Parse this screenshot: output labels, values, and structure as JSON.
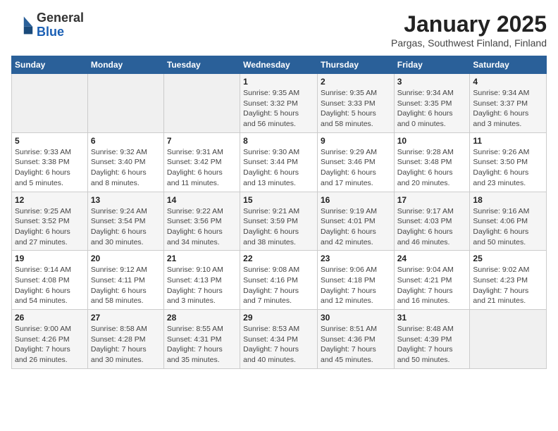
{
  "header": {
    "logo_line1": "General",
    "logo_line2": "Blue",
    "title": "January 2025",
    "subtitle": "Pargas, Southwest Finland, Finland"
  },
  "days_of_week": [
    "Sunday",
    "Monday",
    "Tuesday",
    "Wednesday",
    "Thursday",
    "Friday",
    "Saturday"
  ],
  "weeks": [
    [
      {
        "day": "",
        "info": ""
      },
      {
        "day": "",
        "info": ""
      },
      {
        "day": "",
        "info": ""
      },
      {
        "day": "1",
        "info": "Sunrise: 9:35 AM\nSunset: 3:32 PM\nDaylight: 5 hours\nand 56 minutes."
      },
      {
        "day": "2",
        "info": "Sunrise: 9:35 AM\nSunset: 3:33 PM\nDaylight: 5 hours\nand 58 minutes."
      },
      {
        "day": "3",
        "info": "Sunrise: 9:34 AM\nSunset: 3:35 PM\nDaylight: 6 hours\nand 0 minutes."
      },
      {
        "day": "4",
        "info": "Sunrise: 9:34 AM\nSunset: 3:37 PM\nDaylight: 6 hours\nand 3 minutes."
      }
    ],
    [
      {
        "day": "5",
        "info": "Sunrise: 9:33 AM\nSunset: 3:38 PM\nDaylight: 6 hours\nand 5 minutes."
      },
      {
        "day": "6",
        "info": "Sunrise: 9:32 AM\nSunset: 3:40 PM\nDaylight: 6 hours\nand 8 minutes."
      },
      {
        "day": "7",
        "info": "Sunrise: 9:31 AM\nSunset: 3:42 PM\nDaylight: 6 hours\nand 11 minutes."
      },
      {
        "day": "8",
        "info": "Sunrise: 9:30 AM\nSunset: 3:44 PM\nDaylight: 6 hours\nand 13 minutes."
      },
      {
        "day": "9",
        "info": "Sunrise: 9:29 AM\nSunset: 3:46 PM\nDaylight: 6 hours\nand 17 minutes."
      },
      {
        "day": "10",
        "info": "Sunrise: 9:28 AM\nSunset: 3:48 PM\nDaylight: 6 hours\nand 20 minutes."
      },
      {
        "day": "11",
        "info": "Sunrise: 9:26 AM\nSunset: 3:50 PM\nDaylight: 6 hours\nand 23 minutes."
      }
    ],
    [
      {
        "day": "12",
        "info": "Sunrise: 9:25 AM\nSunset: 3:52 PM\nDaylight: 6 hours\nand 27 minutes."
      },
      {
        "day": "13",
        "info": "Sunrise: 9:24 AM\nSunset: 3:54 PM\nDaylight: 6 hours\nand 30 minutes."
      },
      {
        "day": "14",
        "info": "Sunrise: 9:22 AM\nSunset: 3:56 PM\nDaylight: 6 hours\nand 34 minutes."
      },
      {
        "day": "15",
        "info": "Sunrise: 9:21 AM\nSunset: 3:59 PM\nDaylight: 6 hours\nand 38 minutes."
      },
      {
        "day": "16",
        "info": "Sunrise: 9:19 AM\nSunset: 4:01 PM\nDaylight: 6 hours\nand 42 minutes."
      },
      {
        "day": "17",
        "info": "Sunrise: 9:17 AM\nSunset: 4:03 PM\nDaylight: 6 hours\nand 46 minutes."
      },
      {
        "day": "18",
        "info": "Sunrise: 9:16 AM\nSunset: 4:06 PM\nDaylight: 6 hours\nand 50 minutes."
      }
    ],
    [
      {
        "day": "19",
        "info": "Sunrise: 9:14 AM\nSunset: 4:08 PM\nDaylight: 6 hours\nand 54 minutes."
      },
      {
        "day": "20",
        "info": "Sunrise: 9:12 AM\nSunset: 4:11 PM\nDaylight: 6 hours\nand 58 minutes."
      },
      {
        "day": "21",
        "info": "Sunrise: 9:10 AM\nSunset: 4:13 PM\nDaylight: 7 hours\nand 3 minutes."
      },
      {
        "day": "22",
        "info": "Sunrise: 9:08 AM\nSunset: 4:16 PM\nDaylight: 7 hours\nand 7 minutes."
      },
      {
        "day": "23",
        "info": "Sunrise: 9:06 AM\nSunset: 4:18 PM\nDaylight: 7 hours\nand 12 minutes."
      },
      {
        "day": "24",
        "info": "Sunrise: 9:04 AM\nSunset: 4:21 PM\nDaylight: 7 hours\nand 16 minutes."
      },
      {
        "day": "25",
        "info": "Sunrise: 9:02 AM\nSunset: 4:23 PM\nDaylight: 7 hours\nand 21 minutes."
      }
    ],
    [
      {
        "day": "26",
        "info": "Sunrise: 9:00 AM\nSunset: 4:26 PM\nDaylight: 7 hours\nand 26 minutes."
      },
      {
        "day": "27",
        "info": "Sunrise: 8:58 AM\nSunset: 4:28 PM\nDaylight: 7 hours\nand 30 minutes."
      },
      {
        "day": "28",
        "info": "Sunrise: 8:55 AM\nSunset: 4:31 PM\nDaylight: 7 hours\nand 35 minutes."
      },
      {
        "day": "29",
        "info": "Sunrise: 8:53 AM\nSunset: 4:34 PM\nDaylight: 7 hours\nand 40 minutes."
      },
      {
        "day": "30",
        "info": "Sunrise: 8:51 AM\nSunset: 4:36 PM\nDaylight: 7 hours\nand 45 minutes."
      },
      {
        "day": "31",
        "info": "Sunrise: 8:48 AM\nSunset: 4:39 PM\nDaylight: 7 hours\nand 50 minutes."
      },
      {
        "day": "",
        "info": ""
      }
    ]
  ]
}
